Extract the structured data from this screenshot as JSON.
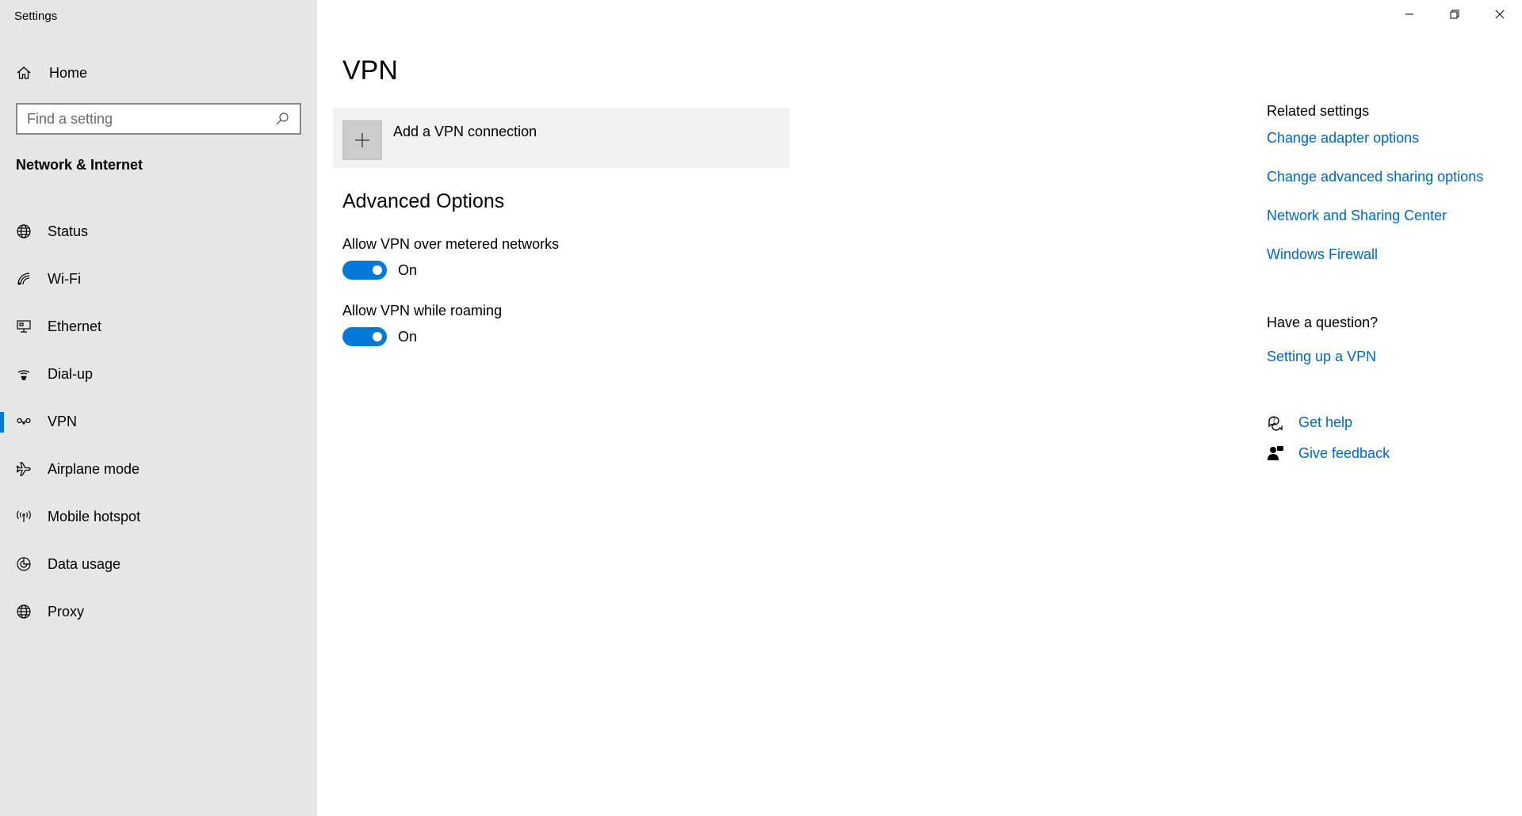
{
  "app": {
    "title": "Settings"
  },
  "sidebar": {
    "home": {
      "label": "Home",
      "icon": "home-icon"
    },
    "search": {
      "placeholder": "Find a setting",
      "value": ""
    },
    "section": "Network & Internet",
    "items": [
      {
        "label": "Status",
        "icon": "globe-status-icon",
        "active": false
      },
      {
        "label": "Wi-Fi",
        "icon": "wifi-icon",
        "active": false
      },
      {
        "label": "Ethernet",
        "icon": "ethernet-icon",
        "active": false
      },
      {
        "label": "Dial-up",
        "icon": "dialup-icon",
        "active": false
      },
      {
        "label": "VPN",
        "icon": "vpn-icon",
        "active": true
      },
      {
        "label": "Airplane mode",
        "icon": "airplane-icon",
        "active": false
      },
      {
        "label": "Mobile hotspot",
        "icon": "hotspot-icon",
        "active": false
      },
      {
        "label": "Data usage",
        "icon": "data-usage-icon",
        "active": false
      },
      {
        "label": "Proxy",
        "icon": "globe-icon",
        "active": false
      }
    ]
  },
  "main": {
    "title": "VPN",
    "add_vpn_label": "Add a VPN connection",
    "advanced_heading": "Advanced Options",
    "settings": [
      {
        "name": "Allow VPN over metered networks",
        "state": "On",
        "enabled": true
      },
      {
        "name": "Allow VPN while roaming",
        "state": "On",
        "enabled": true
      }
    ]
  },
  "right": {
    "related_heading": "Related settings",
    "related_links": [
      "Change adapter options",
      "Change advanced sharing options",
      "Network and Sharing Center",
      "Windows Firewall"
    ],
    "question_heading": "Have a question?",
    "question_link": "Setting up a VPN",
    "get_help": "Get help",
    "give_feedback": "Give feedback"
  },
  "colors": {
    "accent": "#0078d7",
    "link": "#0067c0",
    "sidebar_bg": "#e6e6e6"
  }
}
